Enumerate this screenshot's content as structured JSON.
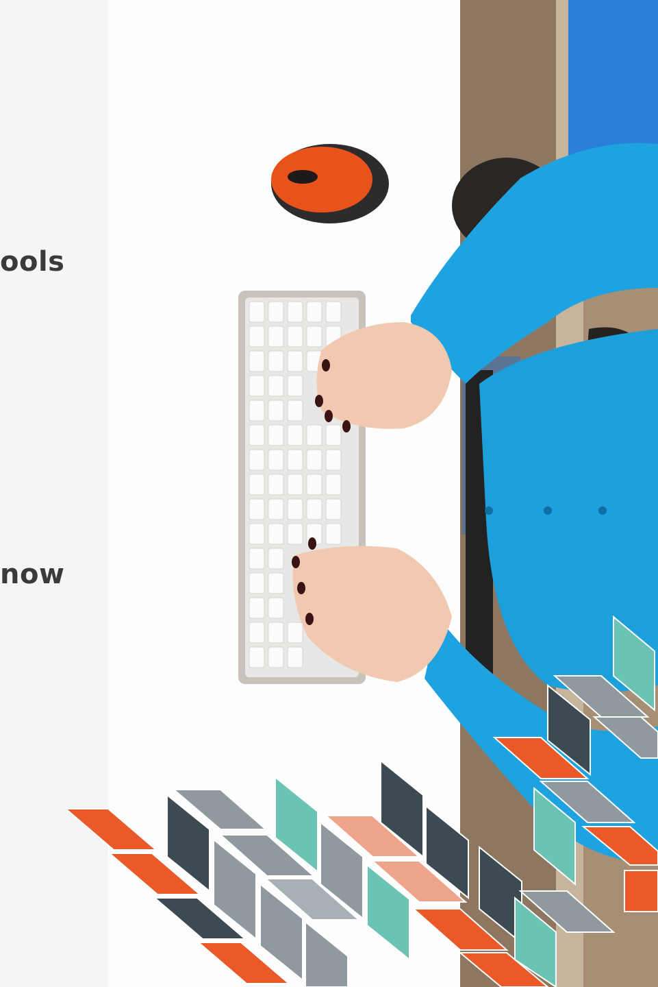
{
  "visible_text": {
    "line_1": "ools",
    "line_2": "now"
  },
  "colors": {
    "background_left": "#f4f5f6",
    "desk": "#fdfdfd",
    "shirt_blue": "#1d9fdc",
    "mouse_orange": "#e8531c",
    "keyboard_frame": "#c8c2bd",
    "tile_orange": "#ea5a28",
    "tile_dark": "#3d4a52",
    "tile_gray": "#8f999e",
    "tile_teal": "#6bc3b4",
    "tile_peach": "#eea48a"
  }
}
